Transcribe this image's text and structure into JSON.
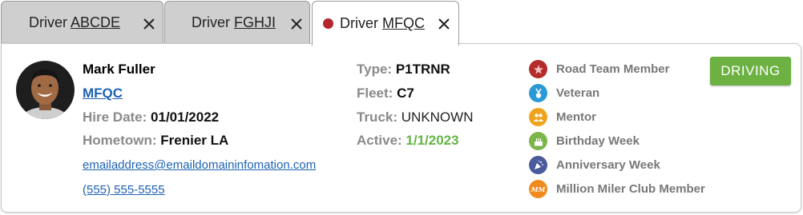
{
  "tabs": [
    {
      "prefix": "Driver ",
      "code": "ABCDE",
      "active": false
    },
    {
      "prefix": "Driver ",
      "code": "FGHJI",
      "active": false
    },
    {
      "prefix": "Driver ",
      "code": "MFQC",
      "active": true,
      "indicator_color": "#b3262b"
    }
  ],
  "driver": {
    "name": "Mark Fuller",
    "code": "MFQC",
    "hire_date_label": "Hire Date:",
    "hire_date": "01/01/2022",
    "hometown_label": "Hometown:",
    "hometown": "Frenier LA",
    "email": "emailaddress@emaildomaininfomation.com",
    "phone": "(555) 555-5555"
  },
  "details": {
    "type_label": "Type:",
    "type": "P1TRNR",
    "fleet_label": "Fleet:",
    "fleet": "C7",
    "truck_label": "Truck:",
    "truck": "UNKNOWN",
    "active_label": "Active:",
    "active": "1/1/2023"
  },
  "badges": [
    {
      "label": "Road Team Member",
      "icon": "star-icon",
      "color": "#b52a2a"
    },
    {
      "label": "Veteran",
      "icon": "medal-icon",
      "color": "#2a9ad6"
    },
    {
      "label": "Mentor",
      "icon": "people-icon",
      "color": "#f0a31c"
    },
    {
      "label": "Birthday Week",
      "icon": "cake-icon",
      "color": "#7ab648"
    },
    {
      "label": "Anniversary Week",
      "icon": "party-icon",
      "color": "#4a5a9c"
    },
    {
      "label": "Million Miler Club Member",
      "icon": "mm-club-icon",
      "color": "#f08a1c",
      "icon_text": "MM"
    }
  ],
  "status": {
    "label": "DRIVING",
    "color": "#6db143"
  }
}
